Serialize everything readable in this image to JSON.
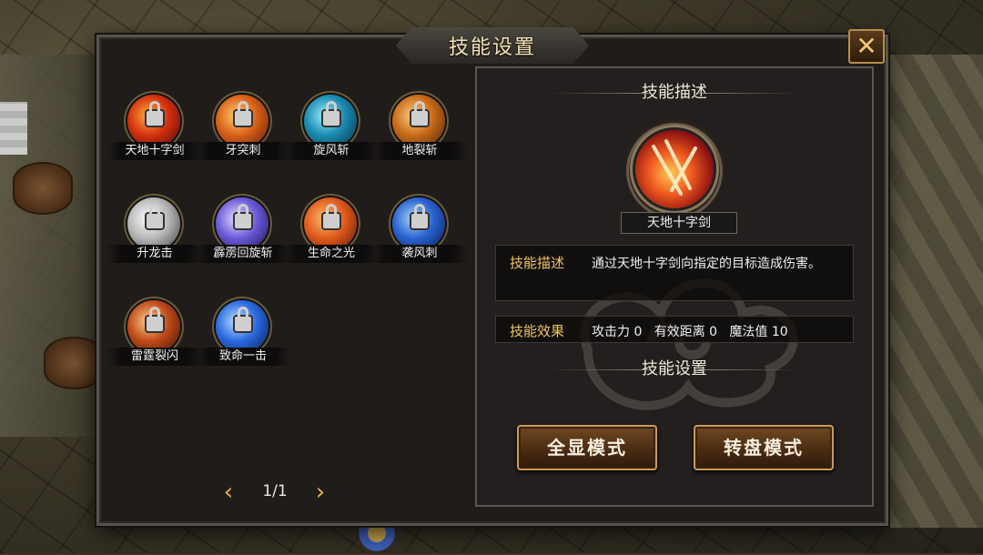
{
  "dialog": {
    "title": "技能设置",
    "close_label": "✕"
  },
  "skills": [
    {
      "name": "天地十字剑",
      "colors": [
        "#ffb040",
        "#d43010",
        "#4a0a06"
      ]
    },
    {
      "name": "牙突刺",
      "colors": [
        "#ffcf70",
        "#d86018",
        "#5a1a06"
      ]
    },
    {
      "name": "旋风斩",
      "colors": [
        "#9ef0ff",
        "#1a8ab0",
        "#063040"
      ]
    },
    {
      "name": "地裂斩",
      "colors": [
        "#ffd080",
        "#c86a18",
        "#4a2206"
      ]
    },
    {
      "name": "升龙击",
      "colors": [
        "#ffffff",
        "#b8b8b8",
        "#3a3a3a"
      ]
    },
    {
      "name": "霹雳回旋斩",
      "colors": [
        "#e6e0ff",
        "#6a5ad8",
        "#1a1446"
      ]
    },
    {
      "name": "生命之光",
      "colors": [
        "#ffc070",
        "#e05a1c",
        "#5a1406"
      ]
    },
    {
      "name": "袭风刺",
      "colors": [
        "#a6d8ff",
        "#2a62d0",
        "#0a1a4a"
      ]
    },
    {
      "name": "雷霆裂闪",
      "colors": [
        "#ffd090",
        "#c04a18",
        "#3a1006"
      ]
    },
    {
      "name": "致命一击",
      "colors": [
        "#bfe2ff",
        "#2a6ae0",
        "#08184a"
      ]
    }
  ],
  "pager": {
    "prev_icon": "‹",
    "next_icon": "›",
    "text": "1/1"
  },
  "detail": {
    "heading": "技能描述",
    "skill_name": "天地十字剑",
    "desc_label": "技能描述",
    "desc_text": "通过天地十字剑向指定的目标造成伤害。",
    "effect_label": "技能效果",
    "effect_text": "攻击力 0   有效距离 0   魔法值 10",
    "settings_heading": "技能设置",
    "btn_full": "全显模式",
    "btn_wheel": "转盘模式"
  },
  "colors": {
    "accent_gold": "#f1c55a",
    "close_border": "#b88c4a"
  }
}
